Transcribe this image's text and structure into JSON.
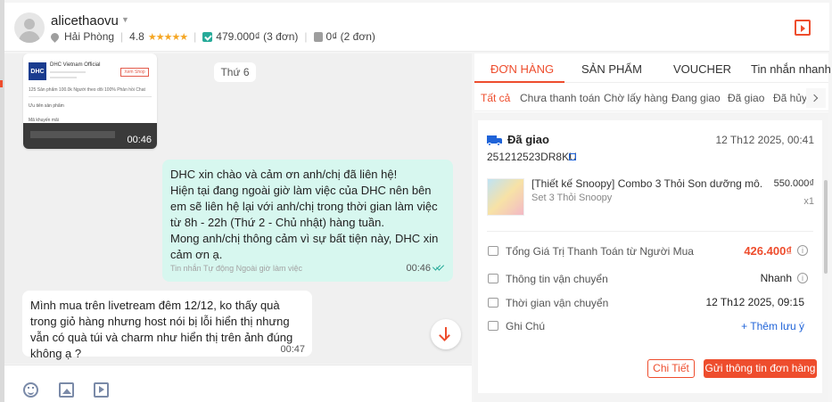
{
  "header": {
    "username": "alicethaovu",
    "location": "Hải Phòng",
    "rating": "4.8",
    "stars": "★★★★★",
    "paid": "479.000₫ (3 đơn)",
    "unpaid": "0₫ (2 đơn)"
  },
  "chat": {
    "video_duration": "00:46",
    "thumb_shop": "DHC Vietnam Official",
    "thumb_btn": "Xem Shop",
    "thumb_stats": "125 Sản phẩm   100.0k Người theo dõi   100% Phản hồi Chat",
    "thumb_line1": "Ưu tiên sản phẩm",
    "thumb_line2": "Mã khuyến mãi",
    "date_chip": "Thứ 6",
    "out_message": "DHC xin chào và cảm ơn anh/chị đã liên hệ!\nHiện tại đang ngoài giờ làm việc của DHC nên bên em sẽ liên hệ lại với anh/chị trong thời gian làm việc từ 8h - 22h (Thứ 2 - Chủ nhật) hàng tuần.\nMong anh/chị thông cảm vì sự bất tiện này, DHC xin cảm ơn ạ.",
    "out_sub": "Tin nhắn Tự động Ngoài giờ làm việc",
    "out_time": "00:46",
    "in_message": "Mình mua trên livetream đêm 12/12, ko thấy quà trong giỏ hàng nhưng host nói bị lỗi hiển thị nhưng vẫn có quà túi và charm như hiển thị trên ảnh đúng không ạ ?",
    "in_time": "00:47"
  },
  "tabs": [
    "ĐƠN HÀNG",
    "SẢN PHẨM",
    "VOUCHER",
    "Tin nhắn nhanh"
  ],
  "subtabs": [
    "Tất cả",
    "Chưa thanh toán",
    "Chờ lấy hàng",
    "Đang giao",
    "Đã giao",
    "Đã hủy"
  ],
  "order": {
    "status": "Đã giao",
    "time": "12 Th12 2025, 00:41",
    "id": "251212523DR8KU",
    "product_name": "[Thiết kế Snoopy] Combo 3 Thỏi Son dưỡng mô...",
    "variation": "Set 3 Thỏi Snoopy",
    "price": "550.000₫",
    "qty": "x1",
    "total_label": "Tổng Giá Trị Thanh Toán từ Người Mua",
    "total_value": "426.400₫",
    "ship_label": "Thông tin vận chuyển",
    "ship_value": "Nhanh",
    "ship_time_label": "Thời gian vận chuyển",
    "ship_time_value": "12 Th12 2025, 09:15",
    "note_label": "Ghi Chú",
    "note_link": "+ Thêm lưu ý",
    "detail_btn": "Chi Tiết",
    "send_btn": "Gửi thông tin đơn hàng"
  },
  "colors": {
    "accent": "#ee4d2d",
    "blue": "#1f63d8",
    "bubble_out": "#d7f7ef"
  }
}
